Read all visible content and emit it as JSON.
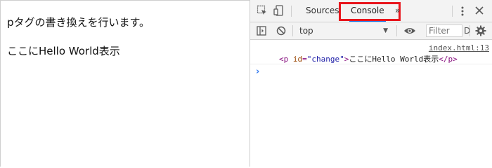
{
  "page": {
    "line1": "pタグの書き換えを行います。",
    "line2": "ここにHello World表示"
  },
  "devtools": {
    "tabs": {
      "sources": "Sources",
      "console": "Console",
      "more": "»"
    },
    "toolbar": {
      "context": "top",
      "filter_placeholder": "Filter",
      "filter_overflow": "D"
    },
    "console": {
      "source": "index.html:13",
      "element": {
        "open_tag": "<p",
        "attr_name": "id",
        "attr_value": "\"change\"",
        "open_close": ">",
        "text": "ここにHello World表示",
        "close_tag": "</p>"
      },
      "prompt": "›"
    },
    "colors": {
      "highlight": "#e8151c",
      "active_tab_underline": "#1a73e8"
    }
  }
}
